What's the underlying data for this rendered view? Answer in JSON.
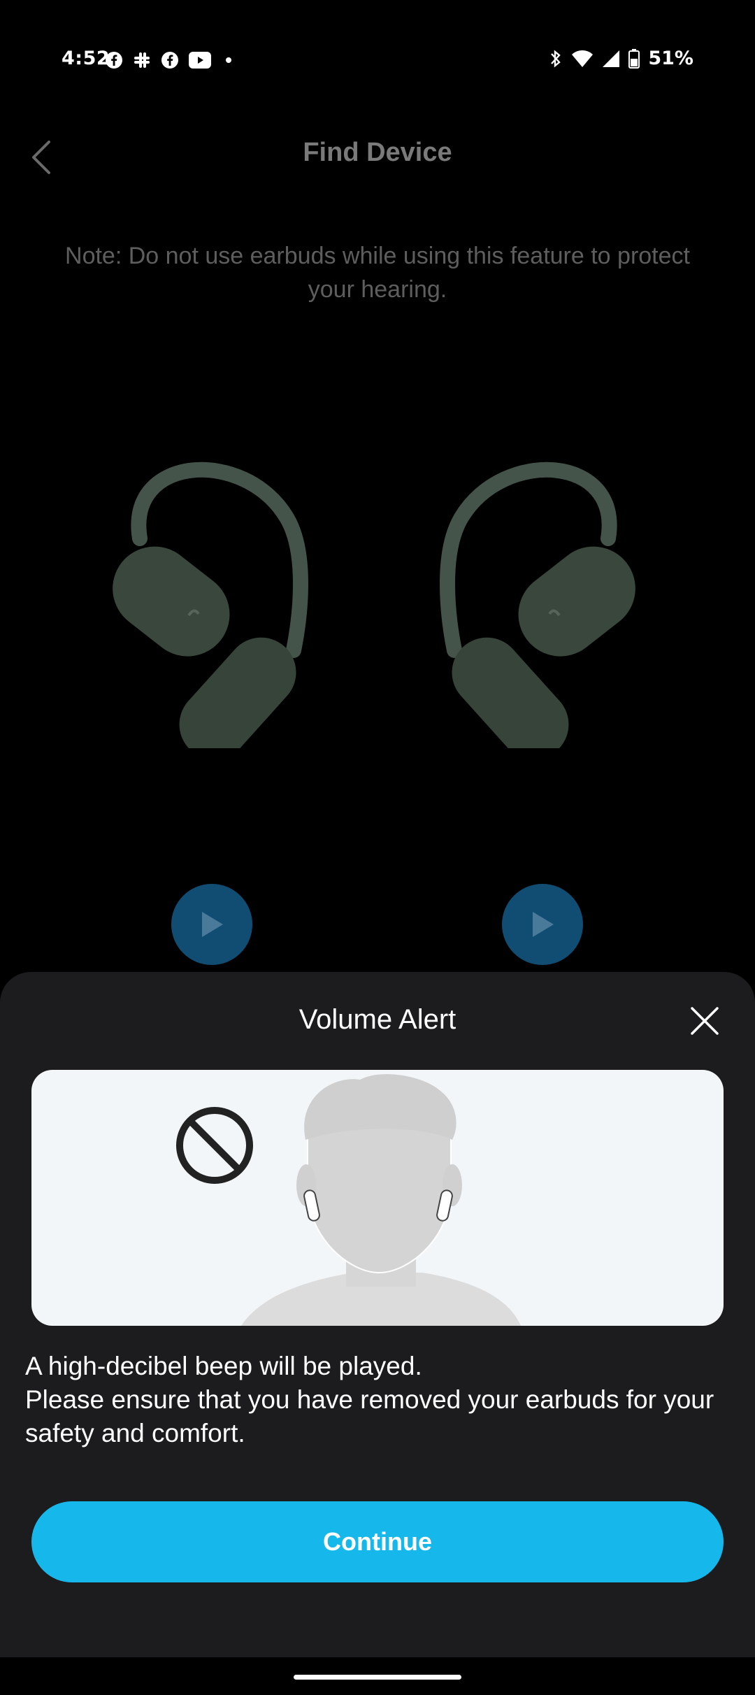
{
  "status_bar": {
    "time": "4:52",
    "battery": "51%",
    "left_icons": [
      "facebook-icon",
      "slack-icon",
      "facebook-icon",
      "youtube-icon",
      "dot-icon"
    ],
    "right_icons": [
      "bluetooth-icon",
      "wifi-icon",
      "signal-icon",
      "battery-icon"
    ]
  },
  "header": {
    "title": "Find Device",
    "back_icon": "chevron-left-icon"
  },
  "note": "Note: Do not use earbuds while using this feature to protect your hearing.",
  "device": {
    "earbud_color": "#3d4a3e",
    "play_buttons": [
      "play-left",
      "play-right"
    ]
  },
  "modal": {
    "title": "Volume Alert",
    "close_icon": "close-icon",
    "message_line1": "A high-decibel beep will be played.",
    "message_line2": "Please ensure that you have removed your earbuds for your safety and comfort.",
    "continue_label": "Continue",
    "accent": "#16b8ec"
  }
}
